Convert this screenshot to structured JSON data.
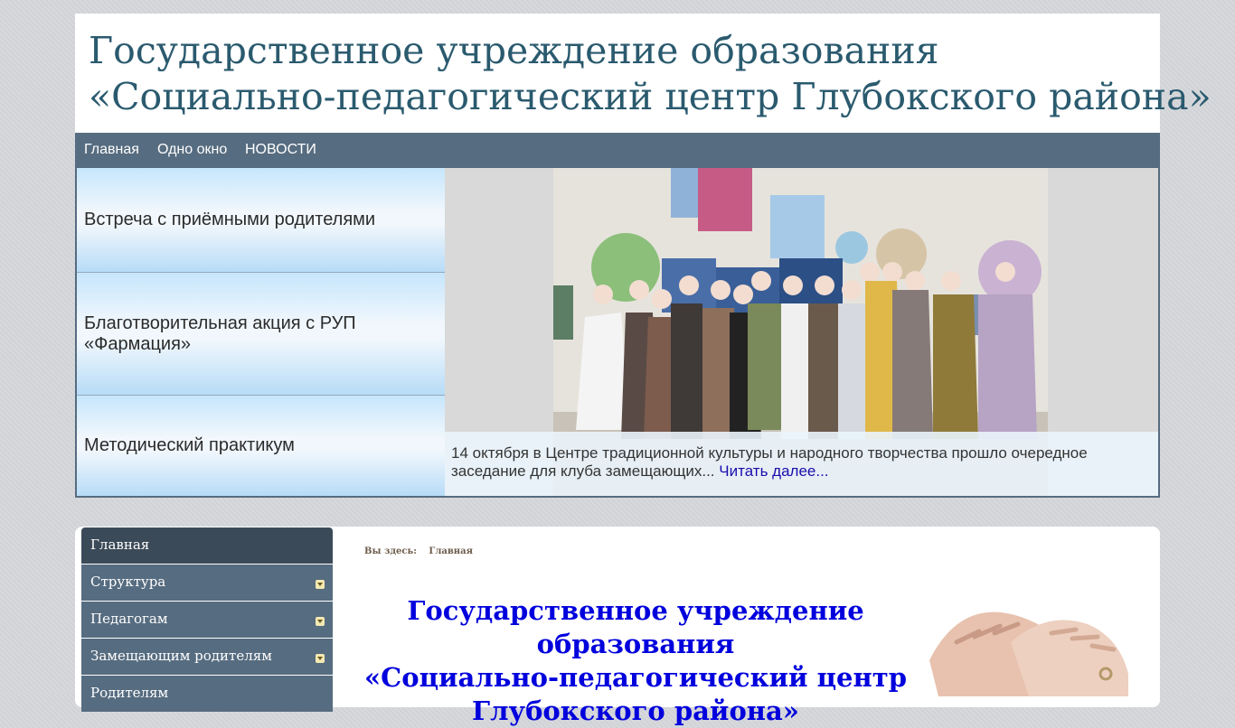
{
  "header": {
    "title_line1": "Государственное учреждение образования",
    "title_line2": "«Социально-педагогический центр Глубокского района»"
  },
  "top_nav": [
    "Главная",
    "Одно окно",
    "НОВОСТИ"
  ],
  "slider": {
    "tabs": [
      "Встреча с приёмными родителями",
      "Благотворительная акция с РУП «Фармация»",
      "Методический практикум"
    ],
    "caption_text": "14 октября в Центре традиционной культуры и народного творчества прошло очередное заседание для клуба замещающих...",
    "read_more": "Читать далее..."
  },
  "side_menu": [
    {
      "label": "Главная",
      "has_submenu": false,
      "active": true
    },
    {
      "label": "Структура",
      "has_submenu": true
    },
    {
      "label": "Педагогам",
      "has_submenu": true
    },
    {
      "label": "Замещающим родителям",
      "has_submenu": true
    },
    {
      "label": "Родителям",
      "has_submenu": false
    }
  ],
  "breadcrumb": {
    "prefix": "Вы здесь:",
    "current": "Главная"
  },
  "main_title": {
    "line1": "Государственное учреждение образования",
    "line2": "«Социально-педагогический центр",
    "line3": "Глубокского района»"
  },
  "colors": {
    "nav_bg": "#566c80",
    "menu_active": "#3b4a58",
    "title_blue": "#0000dd",
    "header_text": "#2a5a6e"
  }
}
